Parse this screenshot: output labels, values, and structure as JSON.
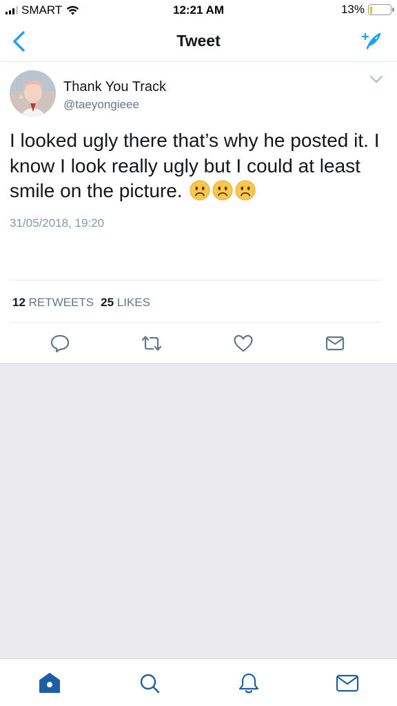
{
  "status_bar": {
    "carrier": "SMART",
    "time": "12:21 AM",
    "battery_percent": "13%",
    "battery_level": 0.13,
    "signal_bars": 3,
    "icons": [
      "signal-bars-icon",
      "wifi-icon",
      "battery-icon"
    ]
  },
  "nav": {
    "title": "Tweet",
    "back_icon": "chevron-left-icon",
    "compose_icon": "compose-quill-icon"
  },
  "tweet": {
    "display_name": "Thank You Track",
    "handle": "@taeyongieee",
    "text": "I looked ugly there that’s why he posted it. I know I look really ugly but I could at least smile on the picture.",
    "emoji": [
      "frowning-face",
      "frowning-face",
      "frowning-face"
    ],
    "timestamp": "31/05/2018, 19:20",
    "retweets_count": "12",
    "retweets_label": "RETWEETS",
    "likes_count": "25",
    "likes_label": "LIKES",
    "actions": [
      "reply-icon",
      "retweet-icon",
      "like-icon",
      "direct-message-icon"
    ]
  },
  "tab_bar": {
    "tabs": [
      "home-icon",
      "search-icon",
      "notifications-icon",
      "messages-icon"
    ],
    "active_tab": "home-icon"
  },
  "colors": {
    "accent": "#1da1f2",
    "text_primary": "#14171a",
    "text_secondary": "#657786",
    "timestamp": "#8899a6",
    "tab_active": "#1c5ea8",
    "background_gray": "#e9e9ee",
    "battery_fill": "#f1c40f"
  }
}
